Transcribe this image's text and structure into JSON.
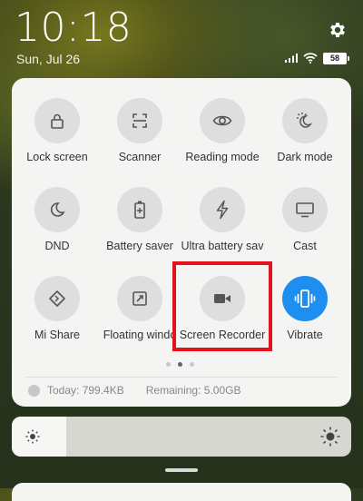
{
  "status_bar": {
    "time": "10:18",
    "date": "Sun, Jul 26",
    "battery": "58"
  },
  "quick_settings": {
    "tiles": [
      {
        "label": "Lock screen",
        "icon": "lock-icon",
        "active": false
      },
      {
        "label": "Scanner",
        "icon": "scanner-icon",
        "active": false
      },
      {
        "label": "Reading mode",
        "icon": "eye-icon",
        "active": false
      },
      {
        "label": "Dark mode",
        "icon": "dark-mode-icon",
        "active": false
      },
      {
        "label": "DND",
        "icon": "moon-icon",
        "active": false
      },
      {
        "label": "Battery saver",
        "icon": "battery-plus-icon",
        "active": false
      },
      {
        "label": "Ultra battery sav",
        "icon": "lightning-icon",
        "active": false
      },
      {
        "label": "Cast",
        "icon": "monitor-icon",
        "active": false
      },
      {
        "label": "Mi Share",
        "icon": "mi-share-icon",
        "active": false
      },
      {
        "label": "Floating windo",
        "icon": "floating-window-icon",
        "active": false
      },
      {
        "label": "Screen Recorder",
        "icon": "video-camera-icon",
        "active": false
      },
      {
        "label": "Vibrate",
        "icon": "vibrate-icon",
        "active": true
      }
    ],
    "page_indicator": {
      "pages": 3,
      "current": 2
    }
  },
  "data_usage": {
    "today": "Today: 799.4KB",
    "remaining": "Remaining: 5.00GB"
  },
  "brightness": {
    "level": 0.16
  },
  "colors": {
    "accent": "#1e8ef0",
    "highlight_box": "#e3131b",
    "panel": "#f4f4f3",
    "tile_inactive": "#dedede"
  }
}
